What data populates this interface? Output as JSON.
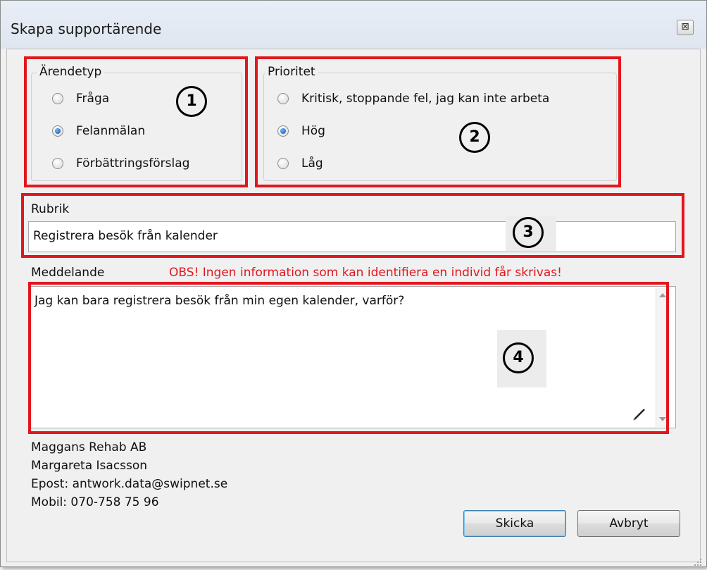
{
  "window": {
    "title": "Skapa supportärende",
    "close_glyph": "⊠"
  },
  "case_type": {
    "legend": "Ärendetyp",
    "options": [
      {
        "label": "Fråga",
        "checked": false
      },
      {
        "label": "Felanmälan",
        "checked": true
      },
      {
        "label": "Förbättringsförslag",
        "checked": false
      }
    ]
  },
  "priority": {
    "legend": "Prioritet",
    "options": [
      {
        "label": "Kritisk, stoppande fel, jag kan inte arbeta",
        "checked": false
      },
      {
        "label": "Hög",
        "checked": true
      },
      {
        "label": "Låg",
        "checked": false
      }
    ]
  },
  "subject": {
    "label": "Rubrik",
    "value": "Registrera besök från kalender"
  },
  "message": {
    "label": "Meddelande",
    "warning": "OBS! Ingen information som kan identifiera en individ får skrivas!",
    "value": "Jag kan bara registrera besök från min egen kalender, varför?"
  },
  "contact": {
    "company": "Maggans Rehab AB",
    "name": "Margareta Isacsson",
    "email": "Epost: antwork.data@swipnet.se",
    "mobile": "Mobil: 070-758 75 96"
  },
  "buttons": {
    "send": "Skicka",
    "cancel": "Avbryt"
  },
  "annotations": {
    "m1": "1",
    "m2": "2",
    "m3": "3",
    "m4": "4"
  },
  "colors": {
    "annotation_red": "#e3161e",
    "warning_red": "#e3161e"
  }
}
